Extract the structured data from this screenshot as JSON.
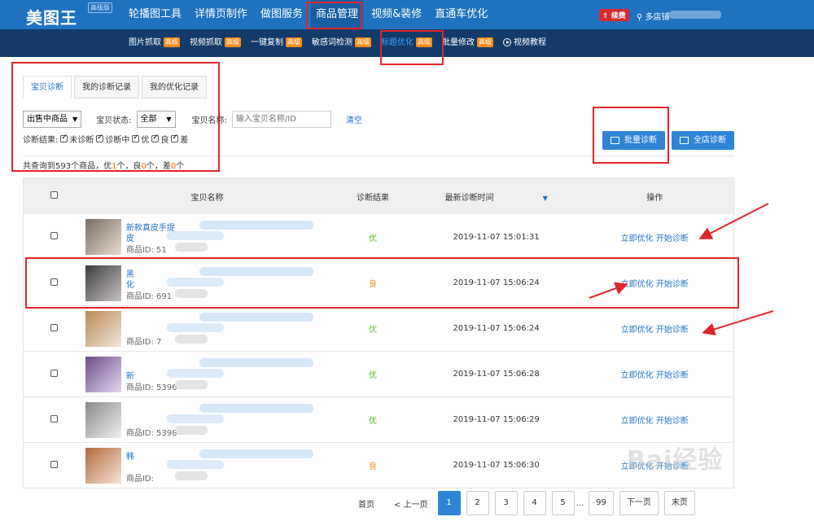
{
  "app": {
    "logo": "美图王",
    "edition": "高级版"
  },
  "main_nav": [
    {
      "label": "轮播图工具",
      "active": false
    },
    {
      "label": "详情页制作",
      "active": false
    },
    {
      "label": "做图服务",
      "active": false
    },
    {
      "label": "商品管理",
      "active": true
    },
    {
      "label": "视频&装修",
      "active": false
    },
    {
      "label": "直通车优化",
      "active": false
    }
  ],
  "header": {
    "renew_label": "续费",
    "shop_label": "多店铺"
  },
  "sub_nav": [
    {
      "label": "图片抓取",
      "tag": "高级",
      "active": false
    },
    {
      "label": "视频抓取",
      "tag": "高级",
      "active": false
    },
    {
      "label": "一键复制",
      "tag": "高级",
      "active": false
    },
    {
      "label": "敏感词检测",
      "tag": "高级",
      "active": false
    },
    {
      "label": "标题优化",
      "tag": "高级",
      "active": true
    },
    {
      "label": "批量修改",
      "tag": "高级",
      "active": false
    },
    {
      "label": "视频教程",
      "tag": "",
      "active": false
    }
  ],
  "tabs": [
    {
      "label": "宝贝诊断",
      "active": true
    },
    {
      "label": "我的诊断记录",
      "active": false
    },
    {
      "label": "我的优化记录",
      "active": false
    }
  ],
  "filters": {
    "status_select": "出售中商品",
    "item_state_label": "宝贝状态:",
    "item_state_value": "全部",
    "name_label": "宝贝名称:",
    "name_placeholder": "输入宝贝名称/ID",
    "clear_label": "清空",
    "diag_label": "诊断结果:",
    "diag_options": [
      "未诊断",
      "诊断中",
      "优",
      "良",
      "差"
    ]
  },
  "summary": {
    "prefix": "共查询到593个商品，优",
    "good": "1",
    "mid1": "个，良",
    "ok": "0",
    "mid2": "个，差",
    "bad": "0",
    "suffix": "个"
  },
  "buttons": {
    "batch_diagnose": "批量诊断",
    "shop_diagnose": "全店诊断"
  },
  "table": {
    "headers": {
      "name": "宝贝名称",
      "result": "诊断结果",
      "time": "最新诊断时间",
      "ops": "操作"
    },
    "rows": [
      {
        "title": "新款真皮手提",
        "title2": "皮",
        "id_label": "商品ID:",
        "id": "51",
        "result": "优",
        "result_type": "good",
        "time": "2019-11-07 15:01:31"
      },
      {
        "title": "黑",
        "title2": "化",
        "id_label": "商品ID:",
        "id": "691",
        "result": "良",
        "result_type": "ok",
        "time": "2019-11-07 15:06:24"
      },
      {
        "title": "",
        "title2": "",
        "id_label": "商品ID:",
        "id": "7",
        "result": "优",
        "result_type": "good",
        "time": "2019-11-07 15:06:24"
      },
      {
        "title": "",
        "title2": "新",
        "id_label": "商品ID:",
        "id": "5396",
        "result": "优",
        "result_type": "good",
        "time": "2019-11-07 15:06:28"
      },
      {
        "title": "",
        "title2": "",
        "id_label": "商品ID:",
        "id": "5398",
        "result": "优",
        "result_type": "good",
        "time": "2019-11-07 15:06:29"
      },
      {
        "title": "韩",
        "title2": "",
        "id_label": "商品ID:",
        "id": "",
        "result": "良",
        "result_type": "ok",
        "time": "2019-11-07 15:06:30"
      }
    ],
    "op_optimize": "立即优化",
    "op_diagnose": "开始诊断"
  },
  "pager": {
    "home": "首页",
    "prev": "< 上一页",
    "pages": [
      "1",
      "2",
      "3",
      "4",
      "5"
    ],
    "ellipsis": "...",
    "last_page": "99",
    "next": "下一页",
    "end": "末页"
  },
  "watermark": "Bai经验"
}
